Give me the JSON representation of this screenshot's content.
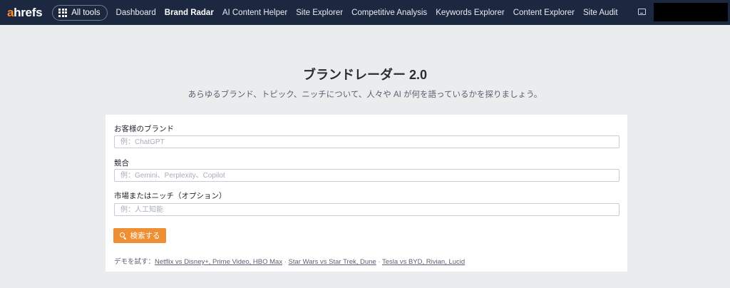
{
  "nav": {
    "logo_accent": "a",
    "logo_rest": "hrefs",
    "all_tools": "All tools",
    "links": [
      {
        "label": "Dashboard",
        "active": false
      },
      {
        "label": "Brand Radar",
        "active": true
      },
      {
        "label": "AI Content Helper",
        "active": false
      },
      {
        "label": "Site Explorer",
        "active": false
      },
      {
        "label": "Competitive Analysis",
        "active": false
      },
      {
        "label": "Keywords Explorer",
        "active": false
      },
      {
        "label": "Content Explorer",
        "active": false
      },
      {
        "label": "Site Audit",
        "active": false
      }
    ],
    "icons": [
      "grid-icon",
      "monitor-icon"
    ]
  },
  "header": {
    "title": "ブランドレーダー 2.0",
    "subtitle": "あらゆるブランド、トピック、ニッチについて、人々や AI が何を語っているかを探りましょう。"
  },
  "form": {
    "brand": {
      "label": "お客様のブランド",
      "placeholder": "例：ChatGPT",
      "value": ""
    },
    "competitors": {
      "label": "競合",
      "placeholder": "例：Gemini、Perplexity、Copilot",
      "value": ""
    },
    "market": {
      "label": "市場またはニッチ（オプション）",
      "placeholder": "例：人工知能",
      "value": ""
    },
    "search_button": "検索する"
  },
  "demo": {
    "prefix": "デモを試す：",
    "separator": " · ",
    "links": [
      "Netflix vs Disney+, Prime Video, HBO Max",
      "Star Wars vs Star Trek, Dune",
      "Tesla vs BYD, Rivian, Lucid"
    ]
  },
  "colors": {
    "nav_bg": "#1c2840",
    "page_bg": "#ebecee",
    "accent": "#ef8f33",
    "logo_accent": "#ff8a1e"
  }
}
